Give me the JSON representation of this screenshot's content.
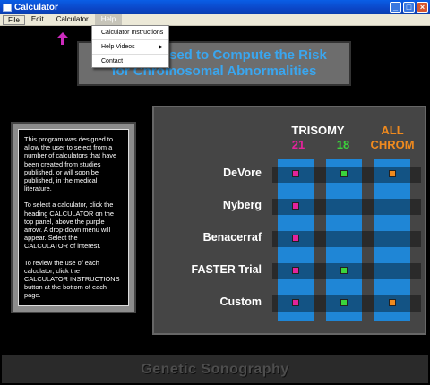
{
  "window": {
    "title": "Calculator"
  },
  "menubar": {
    "items": [
      "File",
      "Edit",
      "Calculator",
      "Help"
    ]
  },
  "help_menu": {
    "items": [
      "Calculator Instructions",
      "Help Videos",
      "Contact"
    ]
  },
  "header": {
    "line1": "Calculators Used to Compute the Risk",
    "line2": "for Chromosomal Abnormalities",
    "visible_line1": "C             Used to Compute the Risk"
  },
  "info": {
    "p1": "This program was designed to allow the user to select  from a number of calculators that have been created from studies published, or will soon be published, in the medical literature.",
    "p2": "To select a calculator, click the heading CALCULATOR on the top panel, above the purple arrow.  A drop-down menu will appear.  Select the CALCULATOR of interest.",
    "p3": "To review the use of each calculator, click the CALCULATOR INSTRUCTIONS button at the bottom of each page."
  },
  "columns": {
    "trisomy": "TRISOMY",
    "t21": "21",
    "t18": "18",
    "all1": "ALL",
    "all2": "CHROM"
  },
  "rows": [
    "DeVore",
    "Nyberg",
    "Benacerraf",
    "FASTER Trial",
    "Custom"
  ],
  "matrix": [
    [
      "pink",
      "green",
      "orange"
    ],
    [
      "pink",
      null,
      null
    ],
    [
      "pink",
      null,
      null
    ],
    [
      "pink",
      "green",
      null
    ],
    [
      "pink",
      "green",
      "orange"
    ]
  ],
  "colors": {
    "t21": "#e3239b",
    "t18": "#3bd43b",
    "all": "#f08a1e",
    "header_text": "#3aa6ef"
  },
  "footer": {
    "text": "Genetic Sonography"
  }
}
